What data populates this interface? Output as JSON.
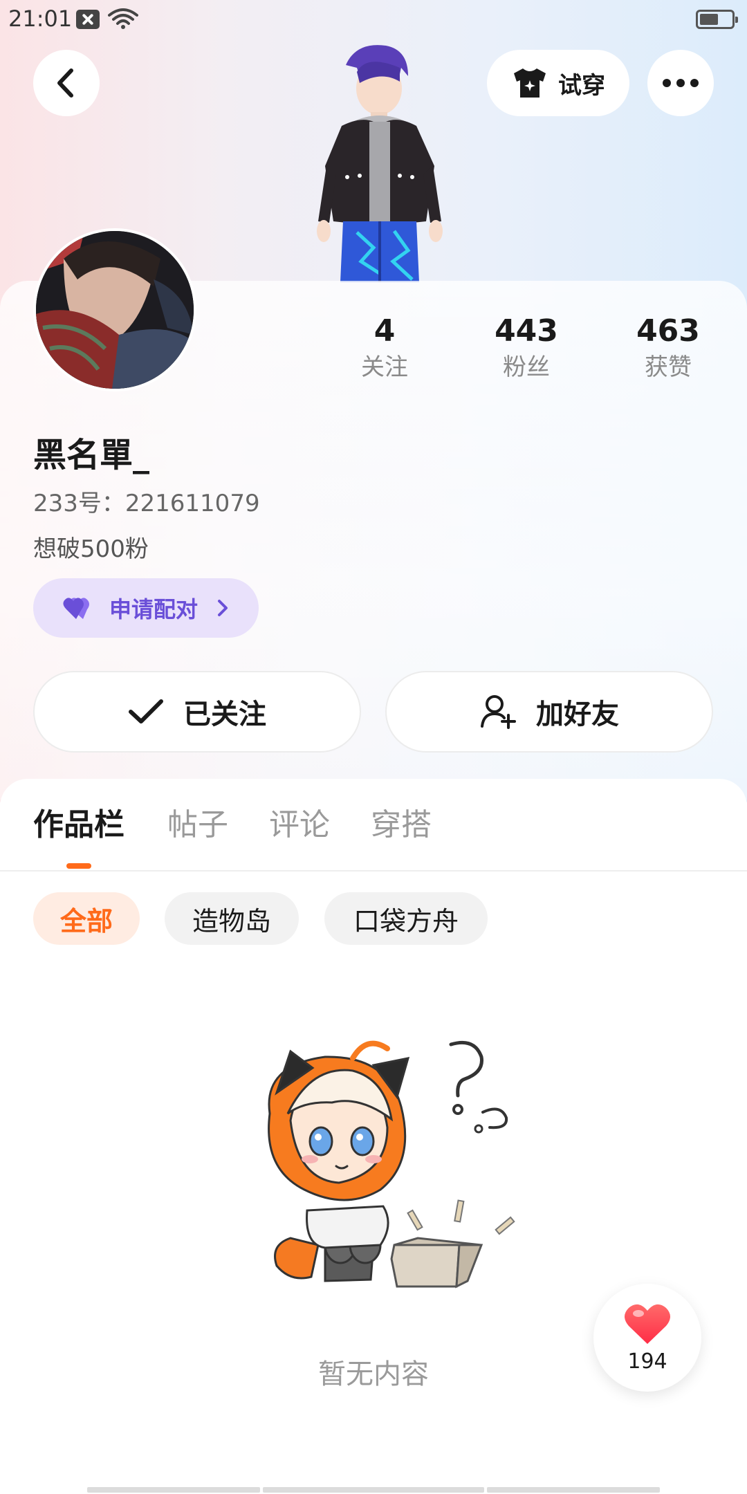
{
  "status_bar": {
    "time": "21:01"
  },
  "header": {
    "try_on_label": "试穿"
  },
  "profile": {
    "username": "黑名單_",
    "uid_text": "233号：221611079",
    "bio": "想破500粉",
    "stats": [
      {
        "value": "4",
        "label": "关注"
      },
      {
        "value": "443",
        "label": "粉丝"
      },
      {
        "value": "463",
        "label": "获赞"
      }
    ],
    "match_label": "申请配对"
  },
  "actions": {
    "follow_label": "已关注",
    "add_friend_label": "加好友"
  },
  "tabs": [
    {
      "label": "作品栏",
      "active": true
    },
    {
      "label": "帖子",
      "active": false
    },
    {
      "label": "评论",
      "active": false
    },
    {
      "label": "穿搭",
      "active": false
    }
  ],
  "filters": [
    {
      "label": "全部",
      "active": true
    },
    {
      "label": "造物岛",
      "active": false
    },
    {
      "label": "口袋方舟",
      "active": false
    }
  ],
  "empty_state": {
    "text": "暂无内容"
  },
  "like_float": {
    "count": "194"
  },
  "colors": {
    "accent": "#ff6a1a",
    "match": "#6a4fd8",
    "like": "#ff3b4a"
  }
}
